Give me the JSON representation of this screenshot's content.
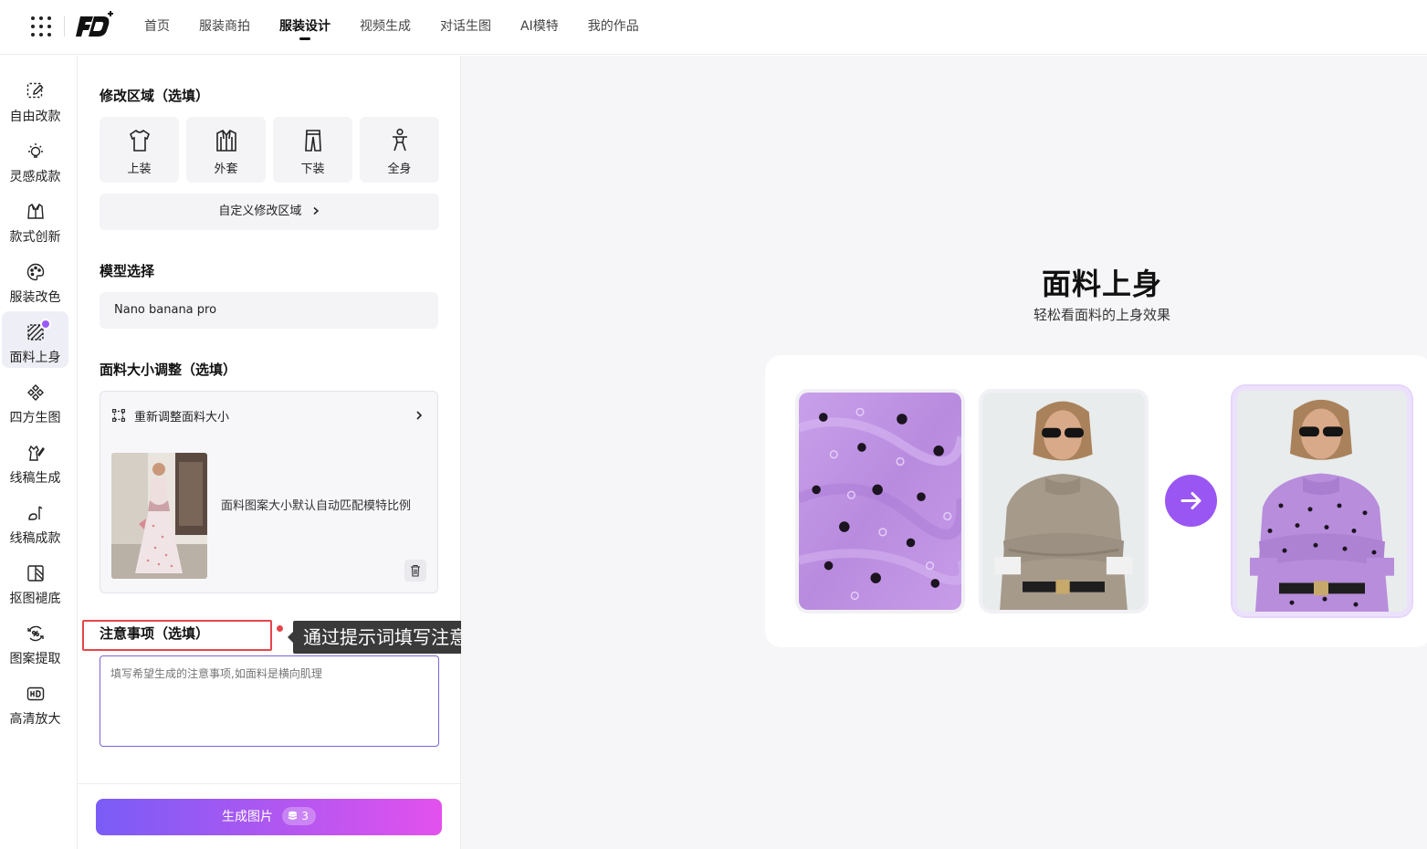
{
  "topbar": {
    "nav": [
      "首页",
      "服装商拍",
      "服装设计",
      "视频生成",
      "对话生图",
      "AI模特",
      "我的作品"
    ],
    "active_index": 2
  },
  "rail": {
    "items": [
      {
        "label": "自由改款",
        "icon": "edit-dashed-icon"
      },
      {
        "label": "灵感成款",
        "icon": "bulb-icon"
      },
      {
        "label": "款式创新",
        "icon": "jacket-icon"
      },
      {
        "label": "服装改色",
        "icon": "palette-icon"
      },
      {
        "label": "面料上身",
        "icon": "fabric-icon"
      },
      {
        "label": "四方生图",
        "icon": "pattern-grid-icon"
      },
      {
        "label": "线稿生成",
        "icon": "sketch-icon"
      },
      {
        "label": "线稿成款",
        "icon": "line-to-garment-icon"
      },
      {
        "label": "抠图褪底",
        "icon": "cutout-icon"
      },
      {
        "label": "图案提取",
        "icon": "pattern-extract-icon"
      },
      {
        "label": "高清放大",
        "icon": "hd-icon"
      }
    ],
    "active_index": 4
  },
  "panel": {
    "region_title": "修改区域（选填）",
    "regions": [
      {
        "label": "上装",
        "icon": "shirt-icon"
      },
      {
        "label": "外套",
        "icon": "coat-icon"
      },
      {
        "label": "下装",
        "icon": "pants-icon"
      },
      {
        "label": "全身",
        "icon": "full-body-icon"
      }
    ],
    "custom_region": "自定义修改区域",
    "model_title": "模型选择",
    "model_value": "Nano banana pro",
    "fabric_title": "面料大小调整（选填）",
    "resize_label": "重新调整面料大小",
    "fabric_hint": "面料图案大小默认自动匹配模特比例",
    "note_title": "注意事项（选填）",
    "note_placeholder": "填写希望生成的注意事项,如面料是横向肌理",
    "generate_label": "生成图片",
    "credits": "3"
  },
  "annotation": {
    "tip": "通过提示词填写注意事项，点击生成"
  },
  "preview": {
    "title": "面料上身",
    "subtitle": "轻松看面料的上身效果"
  },
  "colors": {
    "accent": "#9a56f2",
    "gradient_start": "#7a5cf7",
    "gradient_end": "#e351ee",
    "fabric_lilac": "#c59be6",
    "annotation_red": "#e6454b"
  }
}
